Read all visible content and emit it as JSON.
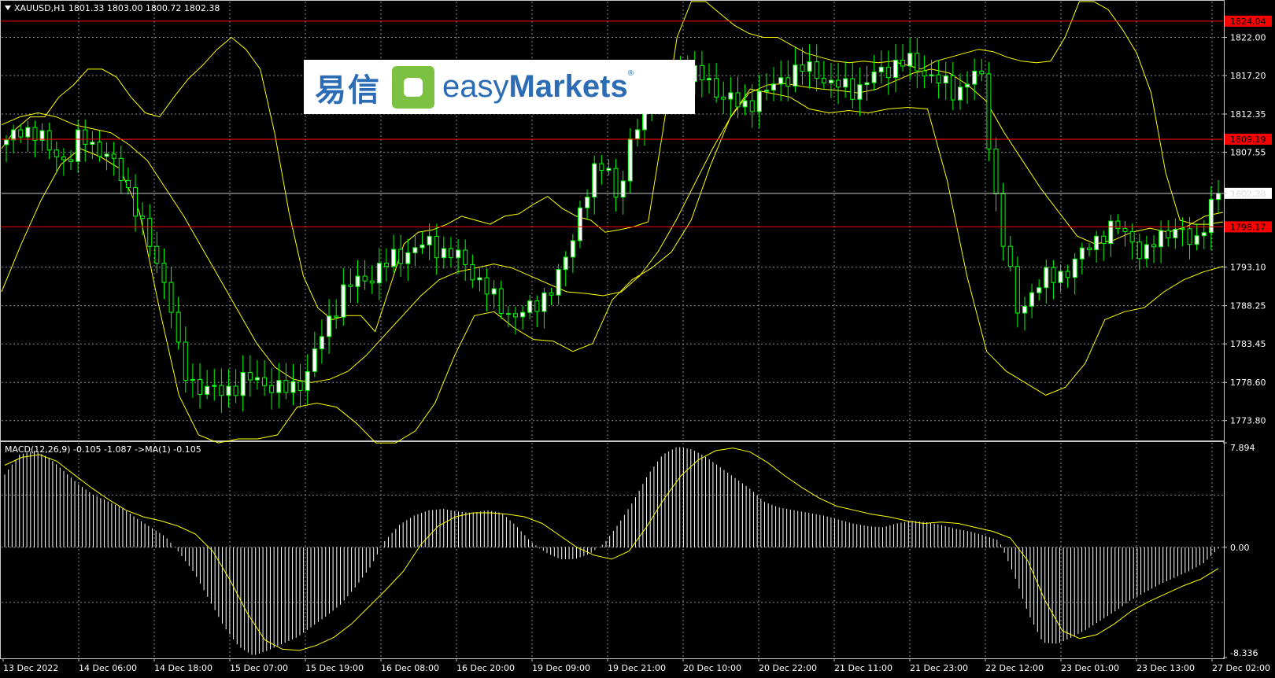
{
  "window": {
    "symbol_line": "XAUUSD,H1  1801.33 1803.00 1800.72 1802.38",
    "indicator_line": "MACD(12,26,9) -0.105 -1.087  ->MA(1) -0.105"
  },
  "logo": {
    "cn": "易信",
    "en_light": "easy",
    "en_bold": "Markets",
    "reg": "®"
  },
  "colors": {
    "background": "#000000",
    "grid": "#8c8c8c",
    "candle_up": "#00ff00",
    "candle_body_up": "#ffffff",
    "bands": "#ffff00",
    "level_line": "#ff0000",
    "level_tag": "#ff0000",
    "current_price_tag": "#ffffff",
    "macd_hist": "#ffffff",
    "macd_signal": "#ffff00"
  },
  "price_axis": {
    "ticks": [
      "1822.00",
      "1817.20",
      "1812.35",
      "1807.55",
      "1802.38",
      "1793.10",
      "1788.25",
      "1783.45",
      "1778.60",
      "1773.80"
    ],
    "current_price": "1802.38",
    "levels": [
      "1824.04",
      "1809.19",
      "1798.17"
    ]
  },
  "macd_axis": {
    "ticks": [
      "7.894",
      "0.00",
      "-8.336"
    ]
  },
  "time_axis": {
    "labels": [
      "13 Dec 2022",
      "14 Dec 06:00",
      "14 Dec 18:00",
      "15 Dec 07:00",
      "15 Dec 19:00",
      "16 Dec 08:00",
      "16 Dec 20:00",
      "19 Dec 09:00",
      "19 Dec 21:00",
      "20 Dec 10:00",
      "20 Dec 22:00",
      "21 Dec 11:00",
      "21 Dec 23:00",
      "22 Dec 12:00",
      "23 Dec 01:00",
      "23 Dec 13:00",
      "27 Dec 02:00"
    ]
  },
  "chart_data": {
    "type": "candlestick",
    "symbol": "XAUUSD",
    "timeframe": "H1",
    "ylim": [
      1771.5,
      1826.5
    ],
    "close_path": [
      1808.5,
      1810.8,
      1810.0,
      1808.8,
      1807.5,
      1806.0,
      1810.0,
      1808.5,
      1806.8,
      1805.5,
      1802.0,
      1797.5,
      1794.0,
      1790.0,
      1780.0,
      1778.5,
      1777.8,
      1777.2,
      1778.0,
      1778.8,
      1779.0,
      1778.4,
      1777.5,
      1778.0,
      1779.5,
      1783.5,
      1787.0,
      1790.2,
      1791.2,
      1791.8,
      1793.0,
      1794.2,
      1795.0,
      1795.5,
      1796.2,
      1795.0,
      1794.5,
      1793.0,
      1791.2,
      1789.0,
      1787.5,
      1787.0,
      1787.8,
      1789.5,
      1791.0,
      1795.0,
      1801.0,
      1804.5,
      1806.5,
      1801.5,
      1808.5,
      1813.5,
      1815.5,
      1817.2,
      1818.0,
      1817.2,
      1816.8,
      1815.0,
      1814.0,
      1813.2,
      1814.5,
      1815.2,
      1816.8,
      1817.5,
      1818.2,
      1817.5,
      1816.0,
      1815.8,
      1815.5,
      1816.5,
      1817.8,
      1818.5,
      1819.0,
      1818.2,
      1817.2,
      1816.0,
      1815.0,
      1816.8,
      1817.5,
      1804.0,
      1794.5,
      1787.0,
      1790.0,
      1791.5,
      1792.0,
      1792.8,
      1794.5,
      1796.5,
      1797.5,
      1798.0,
      1797.0,
      1794.0,
      1796.5,
      1798.0,
      1797.5,
      1795.5,
      1799.5,
      1802.4
    ],
    "bollinger": {
      "upper": [
        1808.0,
        1810.5,
        1812.0,
        1812.0,
        1814.5,
        1816.0,
        1818.0,
        1818.0,
        1817.0,
        1814.5,
        1812.5,
        1812.0,
        1814.5,
        1816.8,
        1818.5,
        1820.5,
        1822.0,
        1820.5,
        1818.0,
        1810.0,
        1800.0,
        1792.0,
        1788.0,
        1786.5,
        1787.0,
        1787.0,
        1785.0,
        1790.5,
        1796.0,
        1797.5,
        1797.8,
        1798.5,
        1799.5,
        1799.0,
        1798.5,
        1799.5,
        1799.8,
        1801.0,
        1802.0,
        1800.5,
        1799.5,
        1799.0,
        1797.5,
        1797.8,
        1798.2,
        1798.8,
        1810.0,
        1822.0,
        1826.5,
        1826.5,
        1825.0,
        1823.5,
        1822.5,
        1822.0,
        1822.0,
        1821.0,
        1820.0,
        1819.5,
        1819.0,
        1818.8,
        1819.0,
        1818.8,
        1819.0,
        1818.5,
        1818.0,
        1819.0,
        1819.5,
        1820.0,
        1820.5,
        1820.2,
        1819.5,
        1819.0,
        1818.8,
        1819.0,
        1822.0,
        1826.5,
        1826.5,
        1825.5,
        1823.0,
        1820.0,
        1815.0,
        1805.0,
        1799.0,
        1798.5,
        1798.5,
        1798.8
      ],
      "middle": [
        1811.0,
        1812.0,
        1812.5,
        1812.0,
        1811.0,
        1810.5,
        1810.0,
        1808.5,
        1806.5,
        1803.0,
        1799.5,
        1795.5,
        1791.5,
        1787.5,
        1783.5,
        1780.5,
        1779.0,
        1778.6,
        1779.0,
        1780.0,
        1782.0,
        1784.5,
        1787.0,
        1789.5,
        1791.5,
        1792.5,
        1793.0,
        1793.5,
        1793.0,
        1792.0,
        1791.0,
        1790.0,
        1789.8,
        1789.5,
        1790.0,
        1792.0,
        1795.0,
        1799.0,
        1803.5,
        1808.0,
        1812.0,
        1815.0,
        1816.0,
        1816.2,
        1815.8,
        1815.5,
        1815.3,
        1815.0,
        1815.5,
        1816.5,
        1817.5,
        1818.0,
        1817.5,
        1816.0,
        1814.0,
        1810.0,
        1806.5,
        1803.0,
        1800.0,
        1797.0,
        1796.0,
        1796.5,
        1797.5,
        1798.0,
        1797.5,
        1798.2,
        1799.5,
        1800.0
      ],
      "lower": [
        1790.0,
        1796.0,
        1801.5,
        1806.0,
        1808.0,
        1807.0,
        1805.5,
        1800.0,
        1788.0,
        1777.0,
        1772.0,
        1771.0,
        1771.5,
        1771.5,
        1772.0,
        1775.5,
        1776.0,
        1775.5,
        1773.5,
        1771.0,
        1771.0,
        1772.5,
        1776.0,
        1782.0,
        1787.0,
        1787.5,
        1785.5,
        1784.0,
        1783.8,
        1782.5,
        1783.5,
        1789.0,
        1791.5,
        1793.0,
        1795.0,
        1799.0,
        1806.0,
        1812.0,
        1815.5,
        1815.0,
        1814.5,
        1813.0,
        1812.5,
        1812.8,
        1812.5,
        1813.0,
        1813.2,
        1813.0,
        1804.0,
        1792.0,
        1782.5,
        1780.0,
        1778.5,
        1777.0,
        1778.0,
        1781.0,
        1786.5,
        1787.5,
        1788.0,
        1790.0,
        1791.5,
        1792.5,
        1793.2
      ]
    },
    "levels": [
      1824.04,
      1809.19,
      1798.17
    ],
    "current_price": 1802.38,
    "macd": {
      "ylim": [
        -8.336,
        7.894
      ],
      "hist": [
        5.5,
        7.0,
        7.3,
        6.8,
        5.8,
        4.8,
        4.0,
        3.5,
        3.0,
        2.2,
        1.5,
        0.8,
        -0.5,
        -2.0,
        -4.0,
        -6.0,
        -7.5,
        -8.2,
        -7.8,
        -7.3,
        -6.8,
        -6.0,
        -5.2,
        -4.3,
        -3.0,
        -1.5,
        0.5,
        1.7,
        2.4,
        2.8,
        2.9,
        2.7,
        2.6,
        2.8,
        2.6,
        1.6,
        0.4,
        -0.4,
        -0.9,
        -0.9,
        -0.5,
        0.3,
        1.8,
        3.5,
        5.5,
        7.0,
        7.6,
        7.4,
        6.8,
        6.0,
        5.2,
        4.4,
        3.4,
        3.0,
        2.8,
        2.6,
        2.4,
        2.1,
        1.8,
        1.6,
        1.5,
        1.8,
        2.0,
        1.9,
        1.7,
        1.4,
        1.2,
        0.9,
        0.5,
        -2.0,
        -5.0,
        -7.2,
        -7.3,
        -6.8,
        -6.2,
        -5.5,
        -4.8,
        -4.0,
        -3.4,
        -2.8,
        -2.3,
        -1.8,
        -1.2,
        -0.105
      ],
      "signal": [
        6.2,
        6.8,
        7.0,
        6.5,
        5.5,
        4.5,
        3.6,
        2.8,
        2.3,
        2.0,
        1.6,
        1.0,
        -0.3,
        -2.5,
        -5.0,
        -7.0,
        -7.7,
        -7.8,
        -7.4,
        -6.8,
        -5.8,
        -4.5,
        -3.2,
        -1.8,
        0.2,
        1.6,
        2.3,
        2.6,
        2.6,
        2.5,
        2.3,
        1.8,
        0.9,
        0.0,
        -0.6,
        -0.9,
        -0.3,
        1.5,
        3.6,
        5.4,
        6.6,
        7.3,
        7.5,
        7.2,
        6.4,
        5.4,
        4.5,
        3.7,
        3.1,
        2.8,
        2.5,
        2.3,
        2.0,
        1.8,
        1.9,
        1.8,
        1.5,
        1.2,
        0.7,
        -1.0,
        -4.0,
        -6.3,
        -6.9,
        -6.6,
        -5.8,
        -4.8,
        -4.1,
        -3.5,
        -2.9,
        -2.4,
        -1.6
      ]
    }
  }
}
